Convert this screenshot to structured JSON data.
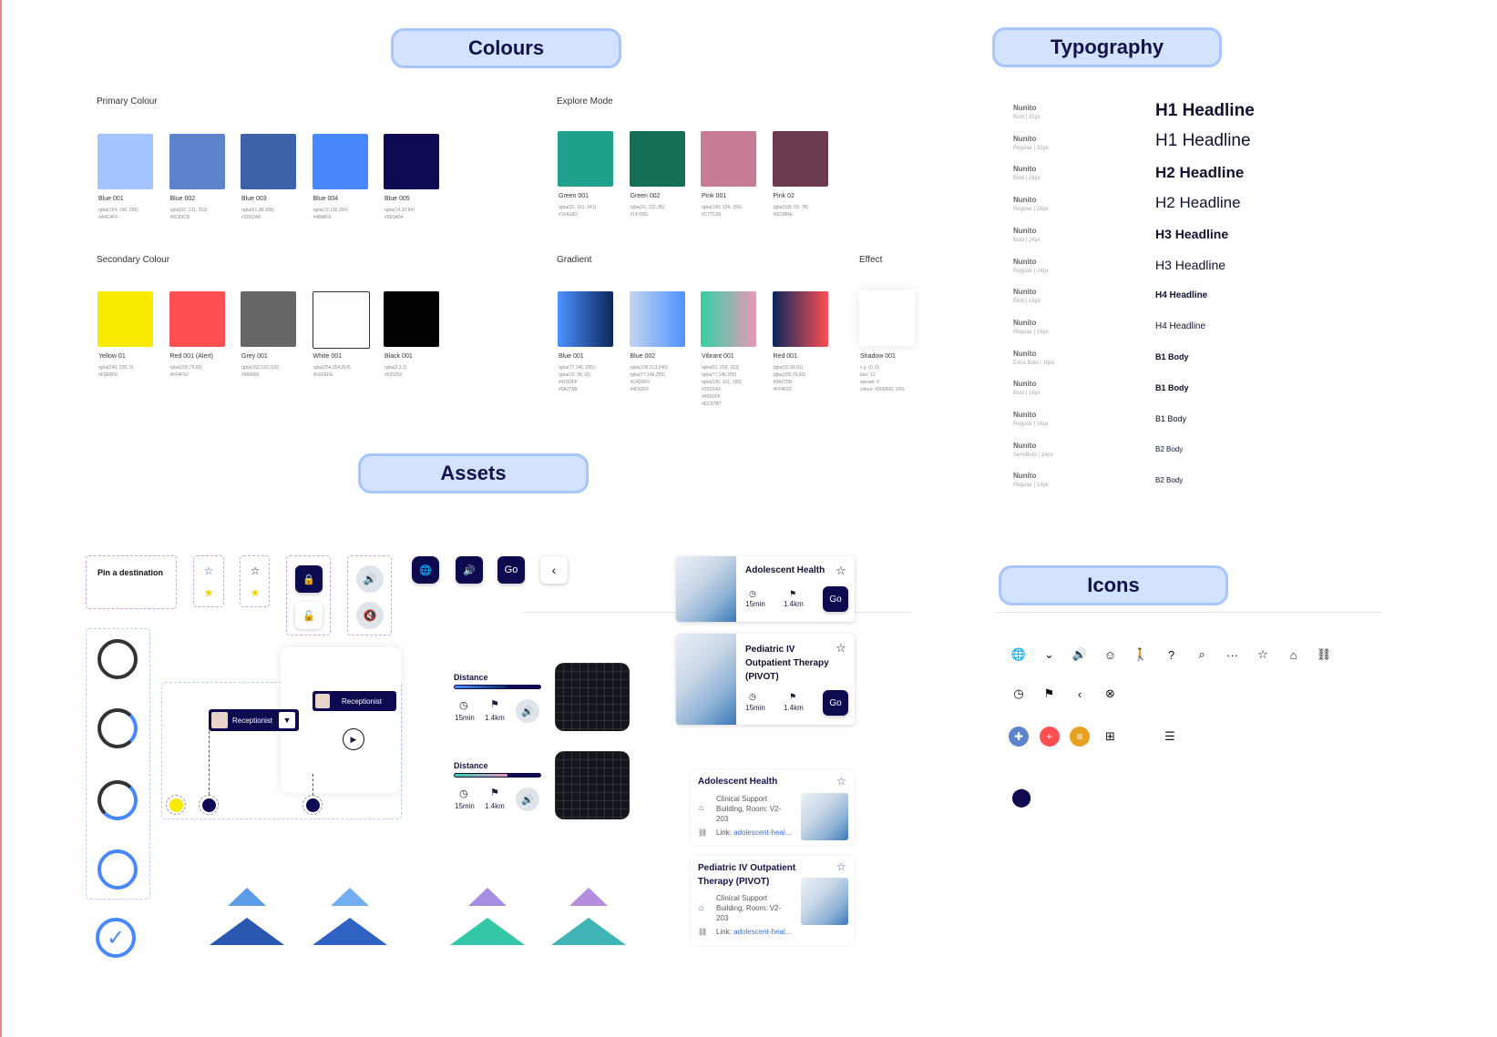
{
  "headings": {
    "colours": "Colours",
    "typography": "Typography",
    "assets": "Assets",
    "icons": "Icons"
  },
  "colours": {
    "primary": {
      "label": "Primary Colour",
      "swatches": [
        {
          "name": "Blue 001",
          "rgba": "rgba(164, 196, 255)",
          "hex": "#A4C4FF",
          "color": "#a4c4ff"
        },
        {
          "name": "Blue 002",
          "rgba": "rgba(92, 131, 203)",
          "hex": "#5C83CB",
          "color": "#5c83cb"
        },
        {
          "name": "Blue 003",
          "rgba": "rgba(61,98,168)",
          "hex": "#3D62A8",
          "color": "#3d62a8"
        },
        {
          "name": "Blue 004",
          "rgba": "rgba(72,136,254)",
          "hex": "#4888FE",
          "color": "#4888fe"
        },
        {
          "name": "Blue 005",
          "rgba": "rgba(14,10,84)",
          "hex": "#0E0A54",
          "color": "#0e0a54"
        }
      ]
    },
    "secondary": {
      "label": "Secondary Colour",
      "swatches": [
        {
          "name": "Yellow 01",
          "rgba": "rgba(249, 235, 0)",
          "hex": "#F9EB00",
          "color": "#f9eb00"
        },
        {
          "name": "Red 001 (Alert)",
          "rgba": "rgba(255,79,82)",
          "hex": "#FF4F52",
          "color": "#ff4f52"
        },
        {
          "name": "Grey 001",
          "rgba": "rgba(102,102,102)",
          "hex": "#666666",
          "color": "#666666"
        },
        {
          "name": "White 001",
          "rgba": "rgba(254,254,254)",
          "hex": "#FEFEFE",
          "color": "#fefefe"
        },
        {
          "name": "Black 001",
          "rgba": "rgba(2,2,2)",
          "hex": "#020202",
          "color": "#020202"
        }
      ]
    },
    "explore": {
      "label": "Explore Mode",
      "swatches": [
        {
          "name": "Green 001",
          "rgba": "rgba(31, 161, 141)",
          "hex": "#1FA18D",
          "color": "#1fa18d"
        },
        {
          "name": "Green 002",
          "rgba": "rgba(20, 112, 85)",
          "hex": "#147055",
          "color": "#147055"
        },
        {
          "name": "Pink 001",
          "rgba": "rgba(199, 124, 150)",
          "hex": "#C77C96",
          "color": "#c77c96"
        },
        {
          "name": "Pink 02",
          "rgba": "rgba(109, 59, 78)",
          "hex": "#6D3B4E",
          "color": "#6d3b4e"
        }
      ]
    },
    "gradient": {
      "label": "Gradient",
      "swatches": [
        {
          "name": "Blue 001",
          "meta": "rgba(77,146, 255)\nrgba(10, 39, 91)\n#4D92FF\n#0A275B",
          "from": "#4d92ff",
          "to": "#0a275b"
        },
        {
          "name": "Blue 002",
          "meta": "rgba(196,213,240)\nrgba(77,146,255)\n#C4D5F0\n#4D92FF",
          "from": "#c4d5f0",
          "to": "#4d92ff"
        },
        {
          "name": "Vibrant 001",
          "meta": "rgba(51, 209, 163)\nrgba(77,146,255)\nrgba(236, 151, 183)\n#33D1A3\n#4D92FF\n#EC97B7",
          "from": "#33d1a3",
          "to": "#ec97b7"
        },
        {
          "name": "Red 001",
          "meta": "rgba(10,39,91)\nrgba(255,79,82)\n#0A275B\n#FF4F52",
          "from": "#0a275b",
          "to": "#ff4f52"
        }
      ]
    },
    "effect": {
      "label": "Effect",
      "name": "Shadow 001",
      "meta": "x,y: (0, 0)\nblur: 12\nspread: 0\ncolour: #000000, 10%"
    }
  },
  "typography": [
    {
      "font": "Nunito",
      "meta": "Bold  |  32px",
      "sample": "H1 Headline",
      "size": 19,
      "weight": "bold"
    },
    {
      "font": "Nunito",
      "meta": "Regular  |  32px",
      "sample": "H1 Headline",
      "size": 19,
      "weight": "normal"
    },
    {
      "font": "Nunito",
      "meta": "Bold  |  28px",
      "sample": "H2 Headline",
      "size": 17,
      "weight": "bold"
    },
    {
      "font": "Nunito",
      "meta": "Regular  |  28px",
      "sample": "H2 Headline",
      "size": 17,
      "weight": "normal"
    },
    {
      "font": "Nunito",
      "meta": "Bold  |  24px",
      "sample": "H3 Headline",
      "size": 14,
      "weight": "bold"
    },
    {
      "font": "Nunito",
      "meta": "Regular  |  24px",
      "sample": "H3 Headline",
      "size": 14,
      "weight": "normal"
    },
    {
      "font": "Nunito",
      "meta": "Bold  |  18px",
      "sample": "H4 Headline",
      "size": 10,
      "weight": "bold"
    },
    {
      "font": "Nunito",
      "meta": "Regular  |  18px",
      "sample": "H4 Headline",
      "size": 10,
      "weight": "normal"
    },
    {
      "font": "Nunito",
      "meta": "Extra Bold  |  16px",
      "sample": "B1 Body",
      "size": 9,
      "weight": "bold"
    },
    {
      "font": "Nunito",
      "meta": "Bold  |  16px",
      "sample": "B1 Body",
      "size": 9,
      "weight": "bold"
    },
    {
      "font": "Nunito",
      "meta": "Regular  |  16px",
      "sample": "B1 Body",
      "size": 9,
      "weight": "normal"
    },
    {
      "font": "Nunito",
      "meta": "SemiBold  |  14px",
      "sample": "B2 Body",
      "size": 8,
      "weight": "normal"
    },
    {
      "font": "Nunito",
      "meta": "Regular  |  14px",
      "sample": "B2 Body",
      "size": 8,
      "weight": "normal"
    }
  ],
  "assets": {
    "pin_label": "Pin a destination",
    "receptionist": "Receptionist",
    "go": "Go",
    "distance_label": "Distance",
    "time": "15min",
    "dist": "1.4km",
    "cards": [
      {
        "title": "Adolescent Health",
        "time": "15min",
        "dist": "1.4km",
        "go": "Go"
      },
      {
        "title": "Pediatric IV Outpatient Therapy (PIVOT)",
        "time": "15min",
        "dist": "1.4km",
        "go": "Go"
      }
    ],
    "info_cards": [
      {
        "title": "Adolescent Health",
        "location": "Clinical Support Building, Room: V2-203",
        "link_prefix": "Link:",
        "link": "adolescent-heal..."
      },
      {
        "title": "Pediatric IV Outpatient Therapy (PIVOT)",
        "location": "Clinical Support Building, Room: V2-203",
        "link_prefix": "Link:",
        "link": "adolescent-heal..."
      }
    ],
    "accent": "#0e0a4f"
  },
  "icons": {
    "row1": [
      "globe-icon",
      "chevron-down-icon",
      "volume-icon",
      "smile-icon",
      "walk-icon",
      "help-icon",
      "search-icon",
      "more-icon",
      "star-icon",
      "home-icon",
      "link-icon"
    ],
    "row2": [
      "clock-icon",
      "flag-icon",
      "chevron-left-icon",
      "close-circle-icon"
    ],
    "row3": [
      "medical-badge-icon",
      "first-aid-badge-icon",
      "food-badge-icon",
      "plus-square-icon",
      "burger-icon"
    ],
    "row4": [
      "map-pin-icon"
    ]
  }
}
